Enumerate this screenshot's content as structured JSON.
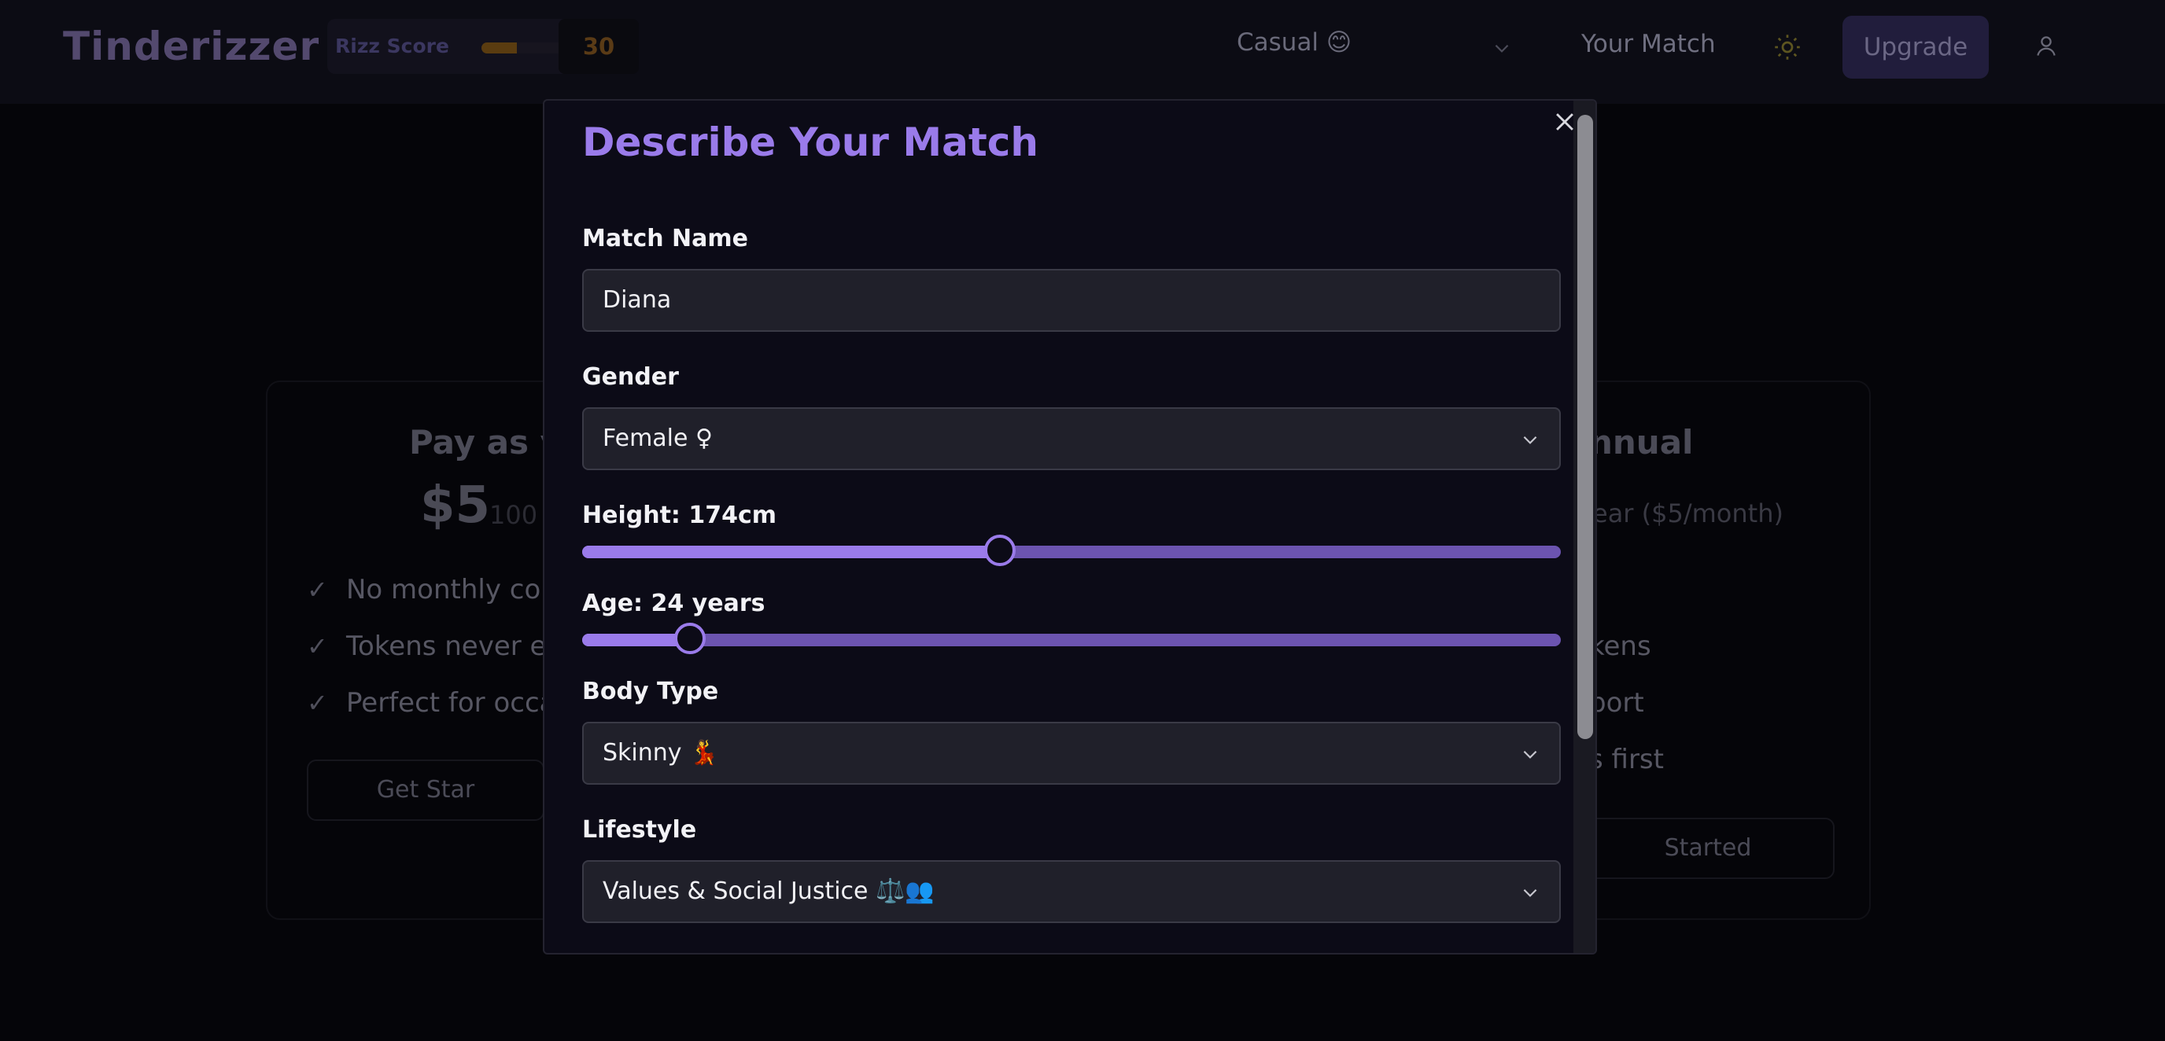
{
  "header": {
    "logo": "Tinderizzer",
    "rizz_label": "Rizz Score",
    "rizz_value": "30",
    "rizz_fraction": 0.3,
    "mode_label": "Casual 😊",
    "nav_match": "Your Match",
    "upgrade_label": "Upgrade"
  },
  "background": {
    "plans": [
      {
        "title": "Pay as y",
        "price": "$5",
        "price_sub": "100 t",
        "features": [
          "No monthly cor",
          "Tokens never ex",
          "Perfect for occa"
        ],
        "button": "Get Star"
      },
      {
        "title": "nnual",
        "price_sub": "ear ($5/month)",
        "features": [
          "kens",
          "port",
          "s first"
        ],
        "button": "Started"
      }
    ]
  },
  "modal": {
    "title": "Describe Your Match",
    "name_label": "Match Name",
    "name_value": "Diana",
    "gender_label": "Gender",
    "gender_value": "Female ♀",
    "height_label": "Height: 174cm",
    "height_fraction": 0.427,
    "age_label": "Age: 24 years",
    "age_fraction": 0.11,
    "body_label": "Body Type",
    "body_value": "Skinny 💃",
    "lifestyle_label": "Lifestyle",
    "lifestyle_value": "Values & Social Justice ⚖️👥"
  },
  "colors": {
    "accent": "#9a7bea",
    "accent_dark": "#6c54b0",
    "modal_bg": "#0c0b17",
    "input_bg": "#20202a"
  },
  "icons": [
    "chevron-down-icon",
    "sun-icon",
    "user-icon",
    "close-icon",
    "check-icon"
  ]
}
